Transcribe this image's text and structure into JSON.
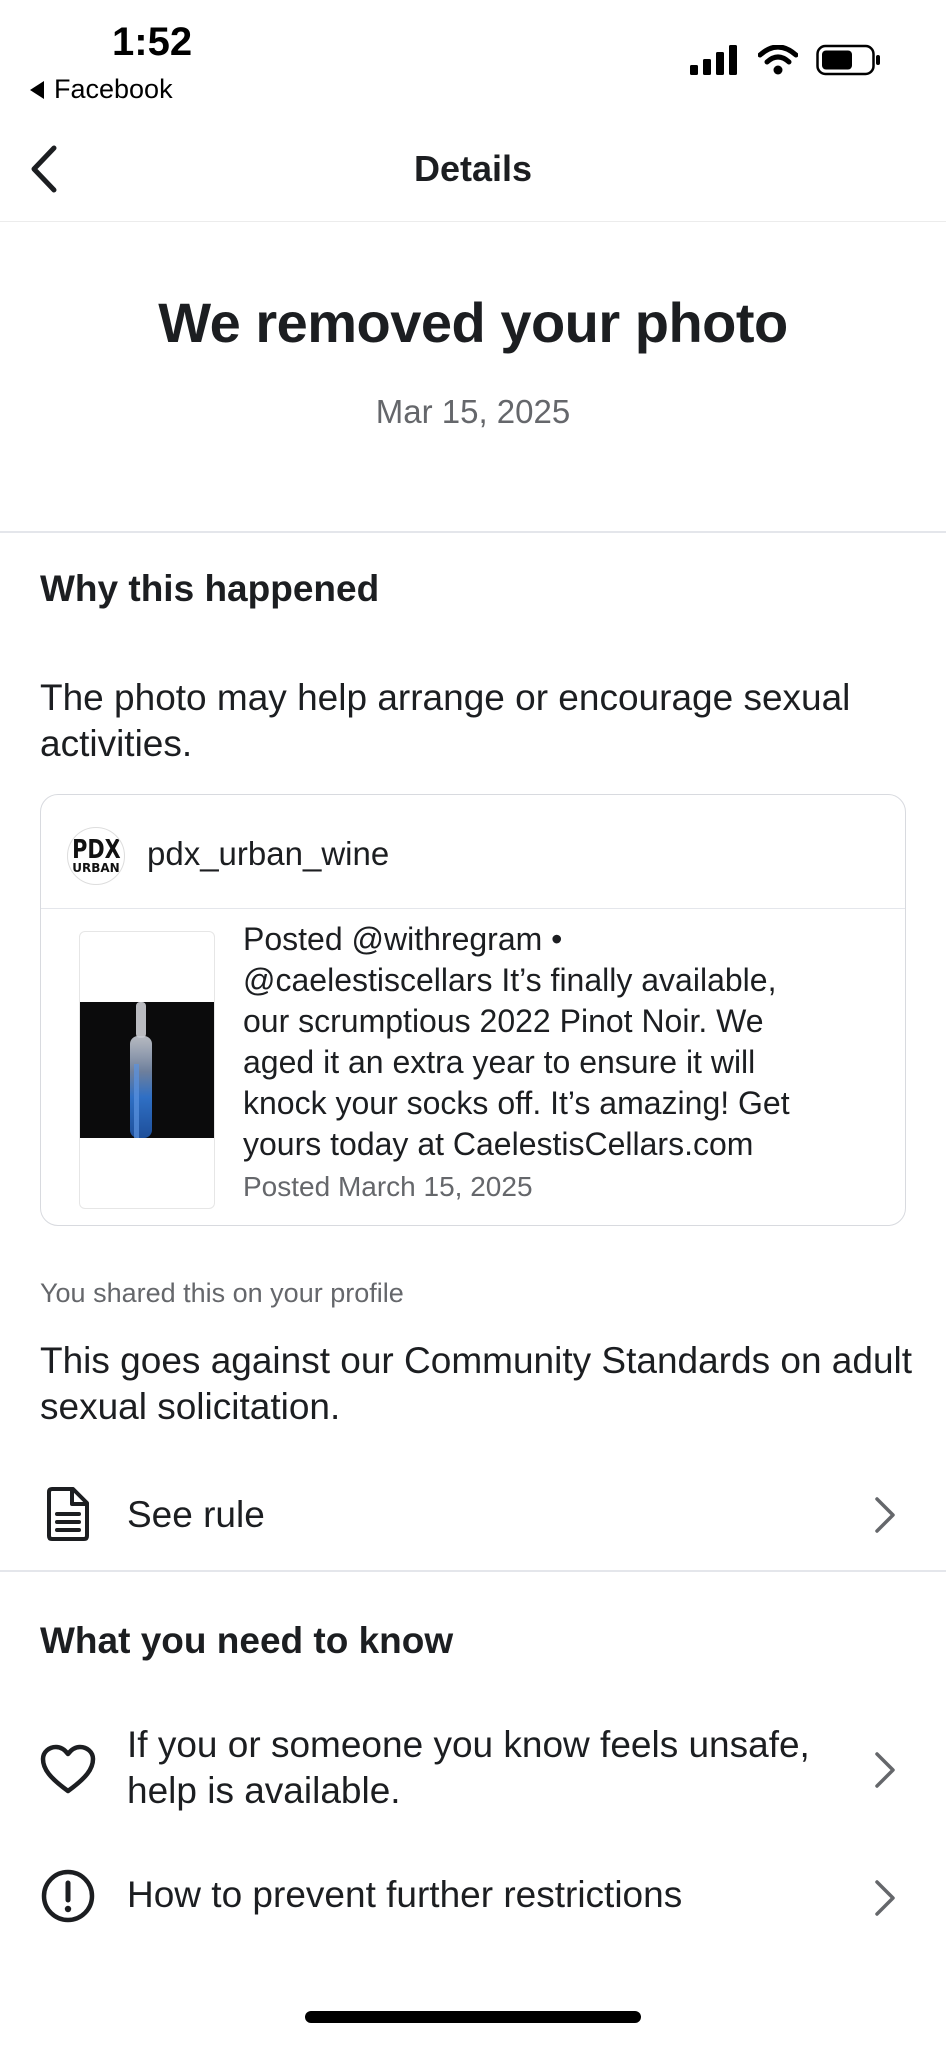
{
  "status_bar": {
    "time": "1:52",
    "back_app": "Facebook"
  },
  "nav": {
    "title": "Details"
  },
  "hero": {
    "title": "We removed your photo",
    "date": "Mar 15, 2025"
  },
  "why": {
    "heading": "Why this happened",
    "reason": "The photo may help arrange or encourage sexual activities."
  },
  "post": {
    "avatar_text_top": "PDX",
    "avatar_text_bottom": "URBAN",
    "username": "pdx_urban_wine",
    "caption_lines": [
      "Posted @withregram •",
      "@caelestiscellars It’s finally available,",
      "our scrumptious 2022 Pinot Noir. We",
      "aged it an extra year to ensure it will",
      "knock your socks off. It’s amazing! Get",
      "yours today at CaelestisCellars.com"
    ],
    "posted_date": "Posted March 15, 2025"
  },
  "shared_note": "You shared this on your profile",
  "violation": {
    "text": "This goes against our Community Standards on adult sexual solicitation.",
    "see_rule_label": "See rule"
  },
  "know": {
    "heading": "What you need to know",
    "items": [
      {
        "label": "If you or someone you know feels unsafe, help is available.",
        "icon": "heart-icon"
      },
      {
        "label": "How to prevent further restrictions",
        "icon": "exclamation-circle-icon"
      }
    ]
  },
  "colors": {
    "text_primary": "#1c1e21",
    "text_secondary": "#65676b",
    "divider": "#e4e6eb",
    "card_border": "#d8dadf"
  }
}
